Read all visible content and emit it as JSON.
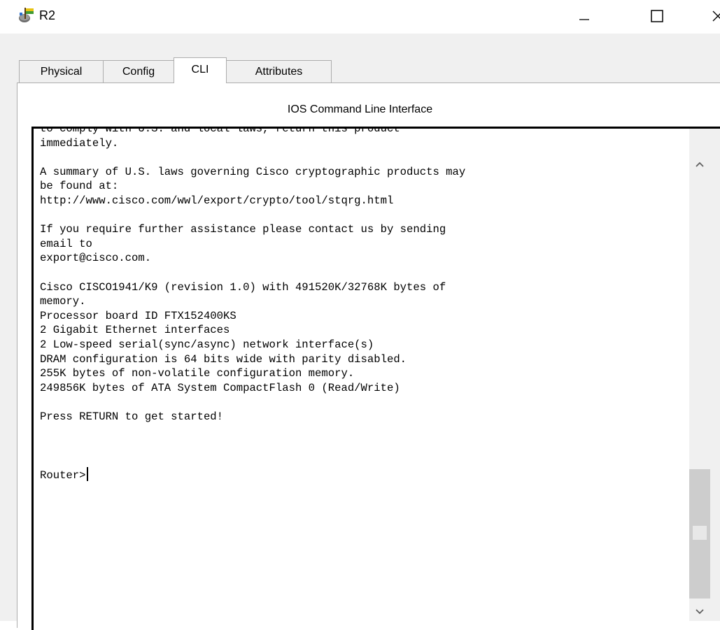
{
  "window": {
    "title": "R2",
    "icon": "router-app-icon",
    "minimize_glyph": "—",
    "maximize_glyph": "☐"
  },
  "tabs": [
    {
      "label": "Physical",
      "active": false
    },
    {
      "label": "Config",
      "active": false
    },
    {
      "label": "CLI",
      "active": true
    },
    {
      "label": "Attributes",
      "active": false
    }
  ],
  "cli": {
    "panel_title": "IOS Command Line Interface",
    "output": "to comply with U.S. and local laws, return this product\nimmediately.\n\nA summary of U.S. laws governing Cisco cryptographic products may\nbe found at:\nhttp://www.cisco.com/wwl/export/crypto/tool/stqrg.html\n\nIf you require further assistance please contact us by sending\nemail to\nexport@cisco.com.\n\nCisco CISCO1941/K9 (revision 1.0) with 491520K/32768K bytes of\nmemory.\nProcessor board ID FTX152400KS\n2 Gigabit Ethernet interfaces\n2 Low-speed serial(sync/async) network interface(s)\nDRAM configuration is 64 bits wide with parity disabled.\n255K bytes of non-volatile configuration memory.\n249856K bytes of ATA System CompactFlash 0 (Read/Write)\n\nPress RETURN to get started!\n\n\n\nRouter>",
    "scroll_position": 0.85
  },
  "colors": {
    "chrome": "#f0f0f0",
    "terminal_bg": "#ffffff",
    "terminal_text": "#000000",
    "scroll_thumb": "#cdcdcd"
  }
}
